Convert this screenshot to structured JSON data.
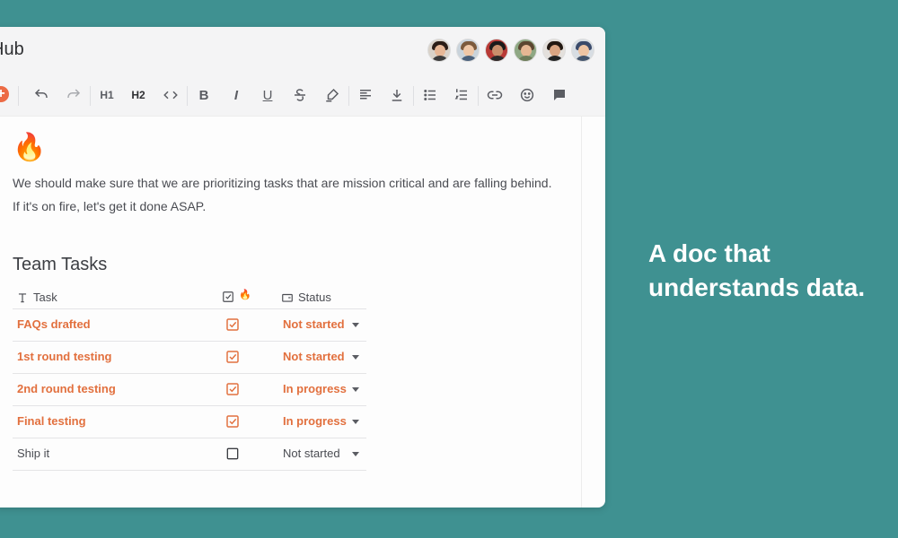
{
  "app": {
    "title": "Hub"
  },
  "toolbar": {
    "icons": [
      "add-icon",
      "undo-icon",
      "redo-icon",
      "heading-1-icon",
      "heading-2-icon",
      "code-icon",
      "bold-icon",
      "italic-icon",
      "underline-icon",
      "strikethrough-icon",
      "highlight-icon",
      "align-left-icon",
      "align-bottom-icon",
      "bullet-list-icon",
      "numbered-list-icon",
      "link-icon",
      "emoji-icon",
      "comment-icon"
    ],
    "h1_label": "H1",
    "h2_label": "H2",
    "bold_label": "B",
    "italic_label": "I",
    "underline_label": "U"
  },
  "doc": {
    "emoji": "🔥",
    "line1": "We should make sure that we are prioritizing tasks that are mission critical and are falling behind.",
    "line2": "If it's on fire, let's get it done ASAP.",
    "heading": "Team Tasks"
  },
  "table": {
    "col_task": "Task",
    "col_check_emoji": "🔥",
    "col_status": "Status",
    "rows": [
      {
        "task": "FAQs drafted",
        "checked": true,
        "status": "Not started"
      },
      {
        "task": "1st round testing",
        "checked": true,
        "status": "Not started"
      },
      {
        "task": "2nd round testing",
        "checked": true,
        "status": "In progress"
      },
      {
        "task": "Final testing",
        "checked": true,
        "status": "In progress"
      },
      {
        "task": "Ship it",
        "checked": false,
        "status": "Not started"
      }
    ]
  },
  "tagline": {
    "line1": "A doc that",
    "line2": "understands data."
  },
  "colors": {
    "background": "#3f9191",
    "accent": "#e2703e",
    "plus_button": "#ec6b45"
  }
}
